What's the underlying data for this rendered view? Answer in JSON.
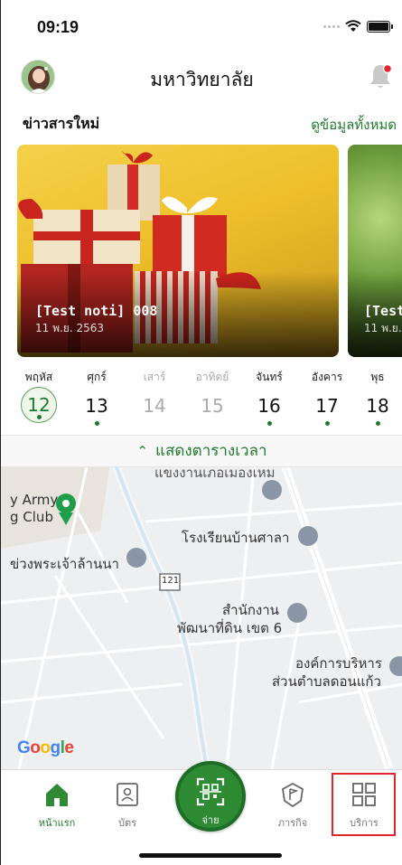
{
  "status": {
    "time": "09:19"
  },
  "header": {
    "title": "มหาวิทยาลัย"
  },
  "news": {
    "title": "ข่าวสารใหม่",
    "see_all": "ดูข้อมูลทั้งหมด",
    "cards": [
      {
        "title": "[Test noti] 008",
        "date": "11 พ.ย. 2563"
      },
      {
        "title": "[Test",
        "date": "11 พ.ย. 2"
      }
    ]
  },
  "week": [
    {
      "name": "พฤหัส",
      "num": "12",
      "today": true,
      "dot": true,
      "muted": false
    },
    {
      "name": "ศุกร์",
      "num": "13",
      "today": false,
      "dot": true,
      "muted": false
    },
    {
      "name": "เสาร์",
      "num": "14",
      "today": false,
      "dot": false,
      "muted": true
    },
    {
      "name": "อาทิตย์",
      "num": "15",
      "today": false,
      "dot": false,
      "muted": true
    },
    {
      "name": "จันทร์",
      "num": "16",
      "today": false,
      "dot": true,
      "muted": false
    },
    {
      "name": "อังคาร",
      "num": "17",
      "today": false,
      "dot": true,
      "muted": false
    },
    {
      "name": "พุธ",
      "num": "18",
      "today": false,
      "dot": true,
      "muted": false
    }
  ],
  "schedule": {
    "label": "แสดงตารางเวลา"
  },
  "map": {
    "labels": {
      "army_1": "y Army",
      "army_2": "g Club",
      "palace": "ข่วงพระเจ้าล้านนา",
      "school": "โรงเรียนบ้านศาลา",
      "office_1": "สำนักงาน",
      "office_2": "พัฒนาที่ดิน เขต 6",
      "org_1": "องค์การบริหาร",
      "org_2": "ส่วนตำบลดอนแก้ว",
      "top": "แขงงานเภอเมองเหม",
      "route": "121",
      "google": "Google"
    }
  },
  "tabbar": {
    "home": "หน้าแรก",
    "card": "บัตร",
    "pay": "จ่าย",
    "tasks": "ภารกิจ",
    "services": "บริการ"
  },
  "colors": {
    "accent": "#1f7a2e",
    "highlight": "#e0262e"
  }
}
